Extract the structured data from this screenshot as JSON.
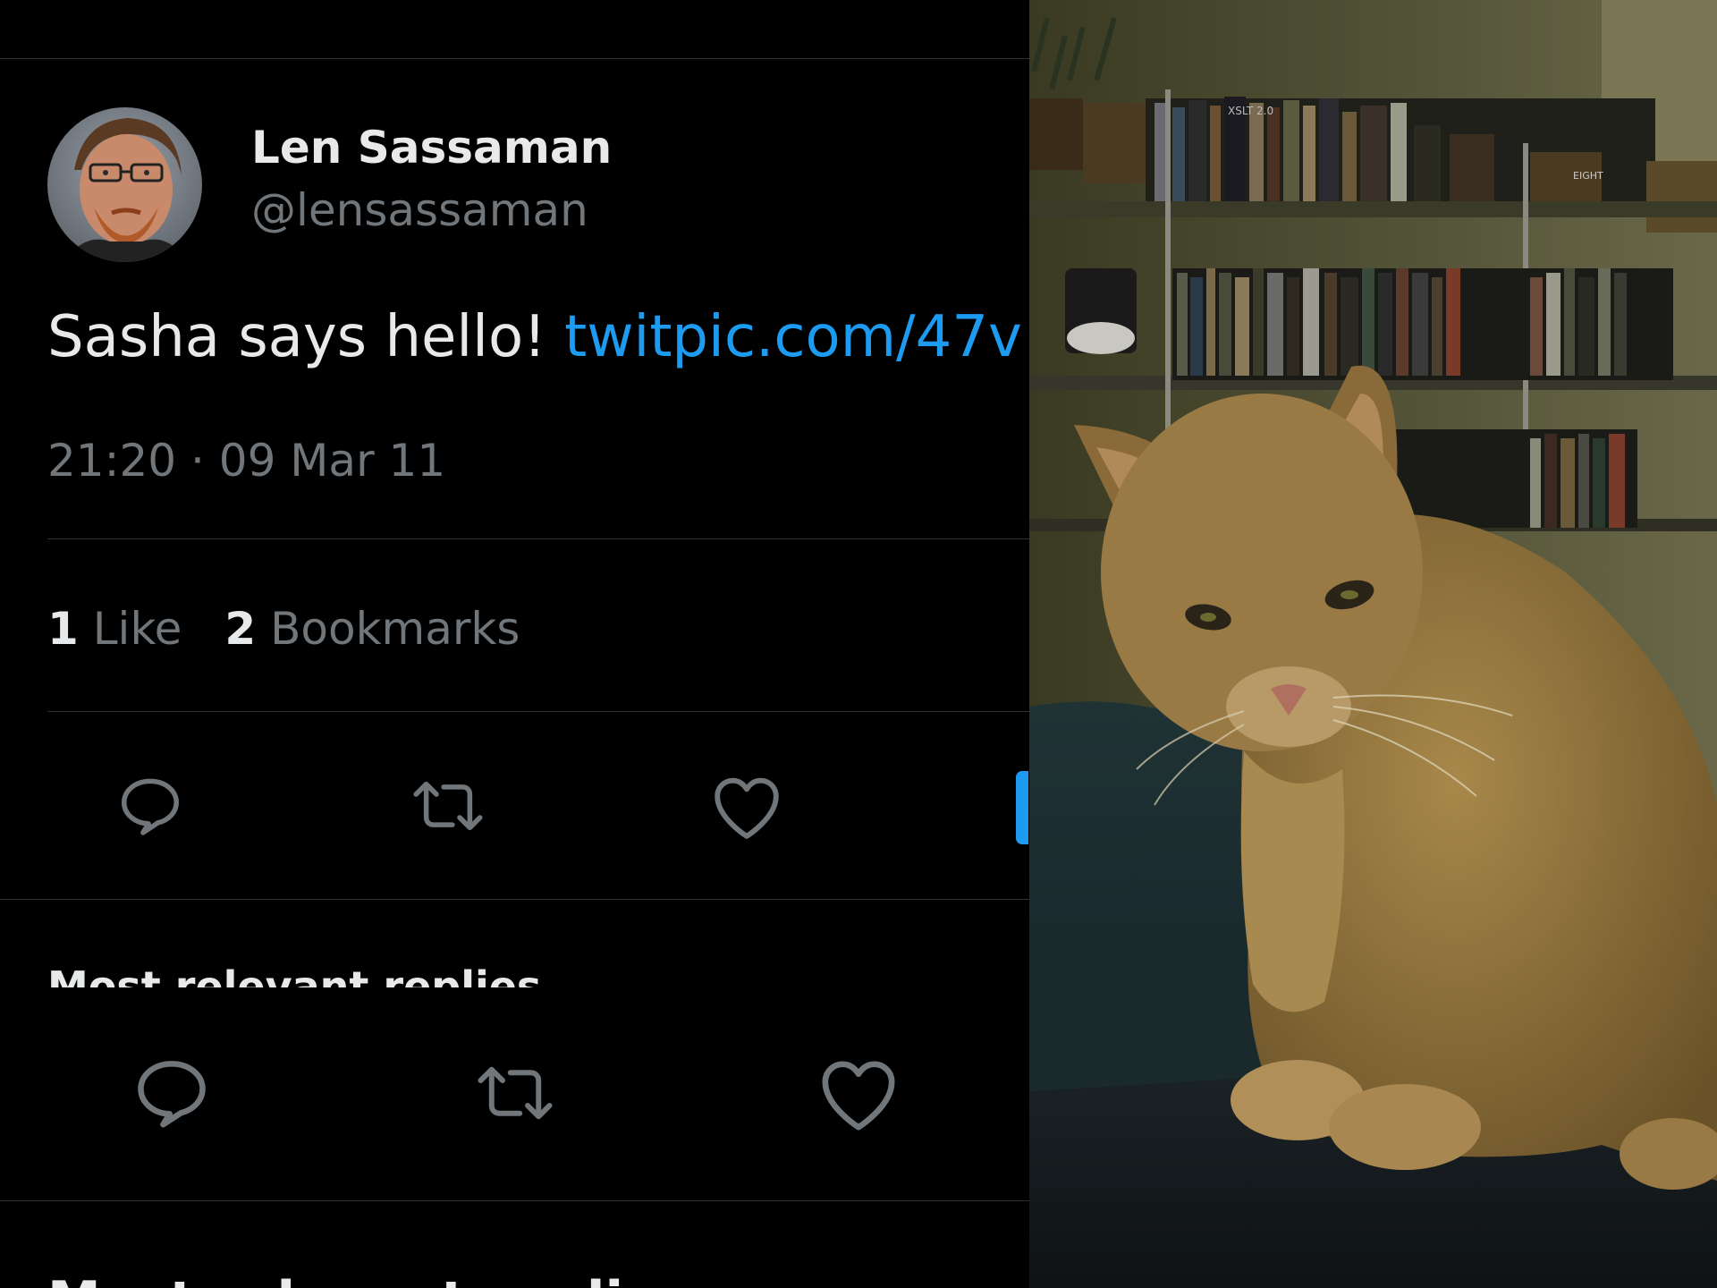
{
  "tweet": {
    "author": {
      "display_name": "Len Sassaman",
      "handle": "@lensassaman"
    },
    "text": "Sasha says hello! ",
    "link_text": "twitpic.com/47v",
    "timestamp": "21:20 · 09 Mar 11",
    "stats": {
      "likes_count": "1",
      "likes_label": "Like",
      "bookmarks_count": "2",
      "bookmarks_label": "Bookmarks"
    },
    "actions": [
      "reply-icon",
      "retweet-icon",
      "like-icon",
      "share-icon"
    ]
  },
  "replies": {
    "sort_label": "Most relevant replies",
    "chevron": "⌄"
  },
  "photo": {
    "subject": "cat-photo",
    "book_spine_texts": [
      "XSLT 2.0",
      "EIGHT"
    ]
  },
  "colors": {
    "background": "#000000",
    "text_primary": "#e7e9ea",
    "text_secondary": "#71767b",
    "link": "#1d9bf0",
    "divider": "#2f3336"
  }
}
